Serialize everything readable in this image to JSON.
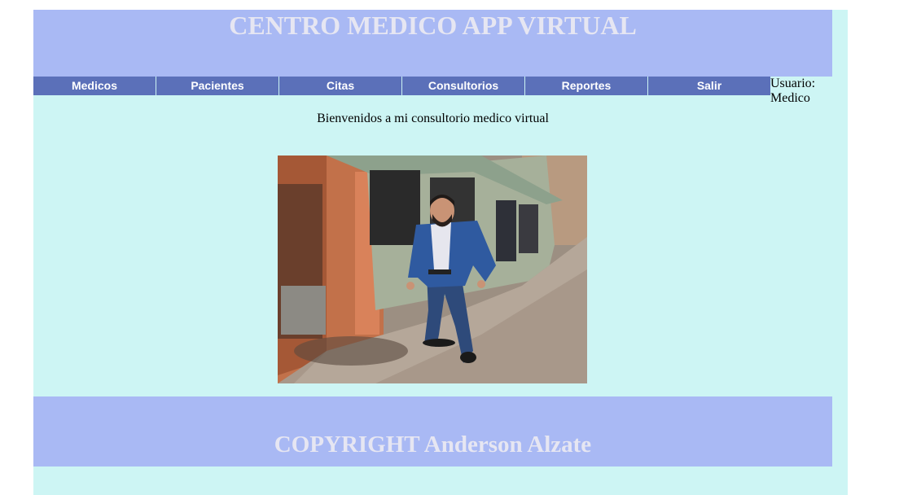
{
  "header": {
    "title": "CENTRO MEDICO APP VIRTUAL"
  },
  "nav": {
    "items": [
      {
        "label": "Medicos"
      },
      {
        "label": "Pacientes"
      },
      {
        "label": "Citas"
      },
      {
        "label": "Consultorios"
      },
      {
        "label": "Reportes"
      },
      {
        "label": "Salir"
      }
    ]
  },
  "user": {
    "label": "Usuario:",
    "role": "Medico"
  },
  "main": {
    "welcome": "Bienvenidos a mi consultorio medico virtual"
  },
  "footer": {
    "copyright": "COPYRIGHT Anderson Alzate"
  },
  "colors": {
    "page_bg": "#cdf5f4",
    "header_bg": "#a9b9f4",
    "nav_bg": "#5b70b9",
    "title_text": "#e6e6f2"
  }
}
